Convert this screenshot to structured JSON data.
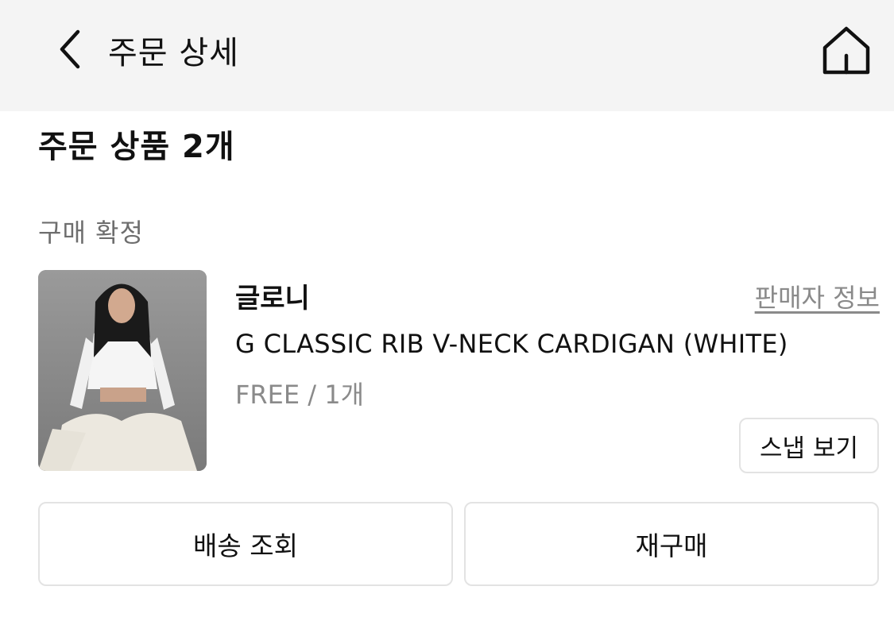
{
  "header": {
    "title": "주문 상세",
    "back_icon": "chevron-left-icon",
    "home_icon": "home-icon"
  },
  "order": {
    "section_title": "주문 상품 2개",
    "status": "구매 확정",
    "item": {
      "brand": "글로니",
      "seller_link": "판매자 정보",
      "product_name": "G CLASSIC RIB V-NECK CARDIGAN (WHITE)",
      "option": "FREE / 1개",
      "snap_button": "스냅 보기"
    },
    "actions": {
      "track": "배송 조회",
      "rebuy": "재구매"
    }
  },
  "colors": {
    "header_bg": "#f4f4f4",
    "muted_text": "#8a8a8a",
    "border": "#e3e3e3"
  }
}
